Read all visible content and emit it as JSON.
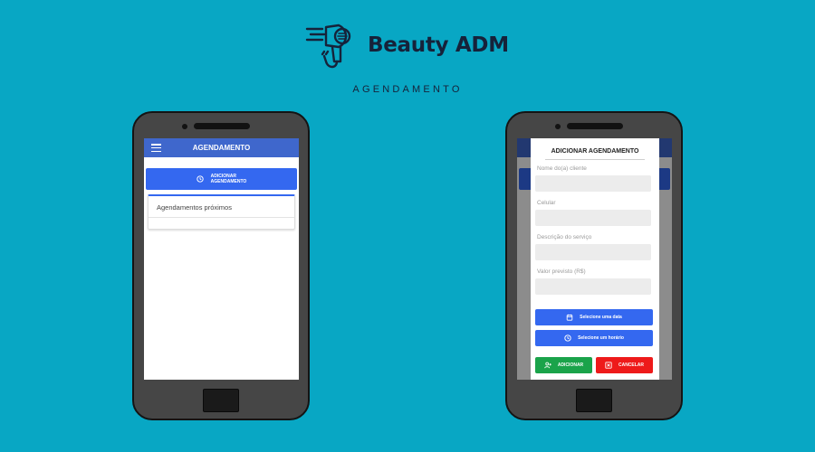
{
  "brand": {
    "name": "Beauty ADM"
  },
  "section_label": "AGENDAMENTO",
  "colors": {
    "background": "#08a7c4",
    "app_bar": "#3f67cc",
    "primary_button": "#3468f0",
    "add_button": "#1aa34a",
    "cancel_button": "#ee1a1a"
  },
  "left_phone": {
    "app_bar_title": "AGENDAMENTO",
    "menu_icon": "hamburger-menu-icon",
    "add_button": {
      "icon": "clock-icon",
      "label_line1": "ADICIONAR",
      "label_line2": "AGENDAMENTO"
    },
    "upcoming_card": {
      "title": "Agendamentos próximos"
    }
  },
  "right_phone": {
    "modal": {
      "title": "ADICIONAR AGENDAMENTO",
      "fields": [
        {
          "label": "Nome do(a) cliente",
          "value": ""
        },
        {
          "label": "Celular",
          "value": ""
        },
        {
          "label": "Descrição do serviço",
          "value": ""
        },
        {
          "label": "Valor previsto (R$)",
          "value": ""
        }
      ],
      "date_button": {
        "icon": "calendar-icon",
        "label": "Selecione uma data"
      },
      "time_button": {
        "icon": "clock-icon",
        "label": "Selecione um horário"
      },
      "add_button": {
        "icon": "add-user-icon",
        "label": "ADICIONAR"
      },
      "cancel_button": {
        "icon": "close-box-icon",
        "label": "CANCELAR"
      }
    }
  }
}
